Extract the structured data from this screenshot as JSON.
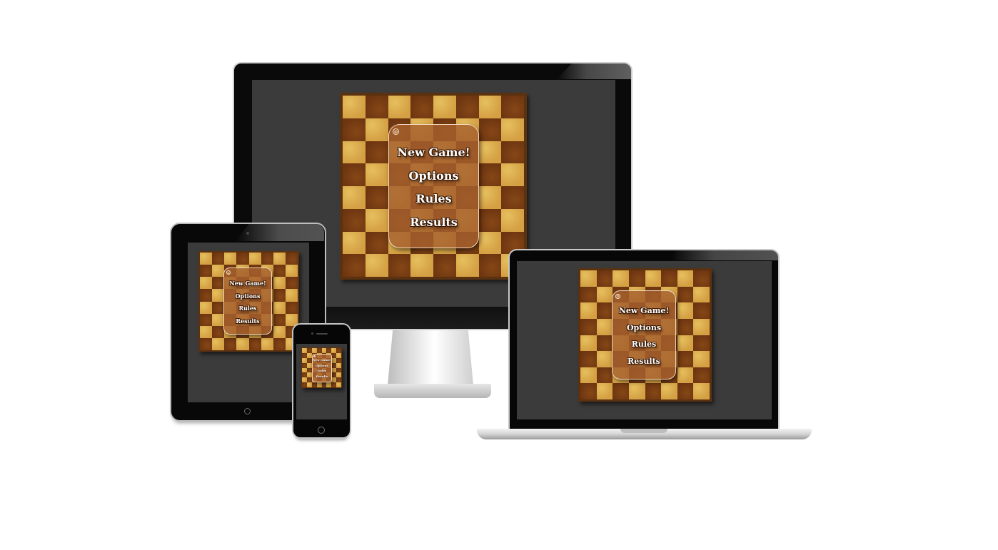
{
  "scene": "responsive-device-mockup",
  "menu": {
    "items": [
      "New Game!",
      "Options",
      "Rules",
      "Results"
    ],
    "close_symbol": "⊗"
  },
  "colors": {
    "board_frame": "#5b3210",
    "board_light": "#d9a84a",
    "board_dark": "#7a3f14",
    "menu_panel": "#a55f2d",
    "screen_bg": "#3b3b3b"
  }
}
